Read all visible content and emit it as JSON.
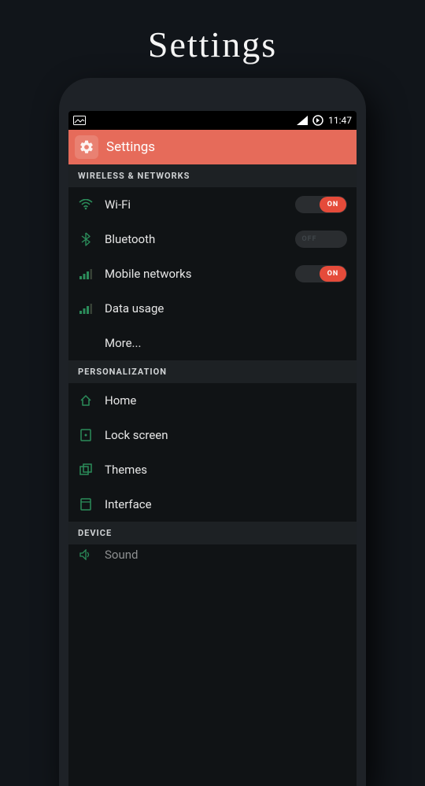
{
  "promo": {
    "title": "Settings"
  },
  "statusbar": {
    "time": "11:47"
  },
  "appbar": {
    "title": "Settings"
  },
  "toggle_labels": {
    "on": "ON",
    "off": "OFF"
  },
  "sections": {
    "wireless": {
      "header": "WIRELESS & NETWORKS",
      "wifi": {
        "label": "Wi-Fi",
        "state": "on"
      },
      "bluetooth": {
        "label": "Bluetooth",
        "state": "off"
      },
      "mobile": {
        "label": "Mobile networks",
        "state": "on"
      },
      "data": {
        "label": "Data usage"
      },
      "more": {
        "label": "More..."
      }
    },
    "personalization": {
      "header": "PERSONALIZATION",
      "home": {
        "label": "Home"
      },
      "lock": {
        "label": "Lock screen"
      },
      "themes": {
        "label": "Themes"
      },
      "interface": {
        "label": "Interface"
      }
    },
    "device": {
      "header": "DEVICE",
      "sound": {
        "label": "Sound"
      }
    }
  }
}
